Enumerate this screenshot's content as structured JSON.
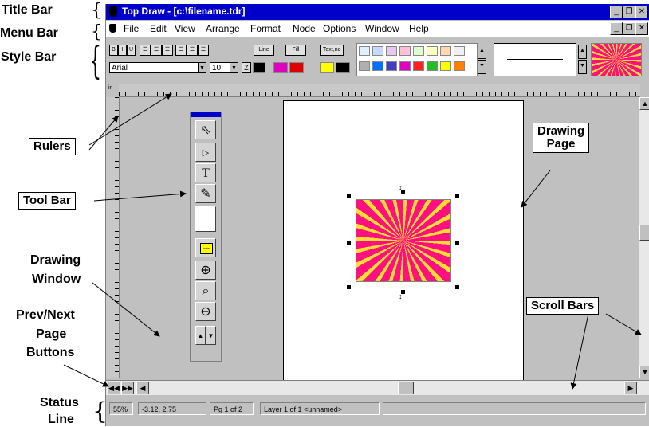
{
  "labels": {
    "title_bar": "Title Bar",
    "menu_bar": "Menu Bar",
    "style_bar": "Style Bar",
    "rulers": "Rulers",
    "tool_bar": "Tool Bar",
    "drawing_window_1": "Drawing",
    "drawing_window_2": "Window",
    "prev_next_1": "Prev/Next",
    "prev_next_2": "Page",
    "prev_next_3": "Buttons",
    "status_line_1": "Status",
    "status_line_2": "Line",
    "drawing_page_1": "Drawing",
    "drawing_page_2": "Page",
    "scroll_bars": "Scroll Bars"
  },
  "window": {
    "title": "Top Draw - [c:\\filename.tdr]"
  },
  "menu": [
    "File",
    "Edit",
    "View",
    "Arrange",
    "Format",
    "Node",
    "Options",
    "Window",
    "Help"
  ],
  "stylebar": {
    "bold": "B",
    "italic": "I",
    "underline": "U",
    "line_btn": "Line",
    "fill_btn": "Fill",
    "text_btn": "Text,nc",
    "font": "Arial",
    "size": "10"
  },
  "toolbox": {
    "text_tool": "T",
    "note_label": "note"
  },
  "status": {
    "zoom": "55%",
    "coords": "-3.12, 2.75",
    "page": "Pg 1 of 2",
    "layer": "Layer 1 of 1 <unnamed>"
  },
  "ruler": {
    "unit": "in"
  },
  "colors": {
    "titlebar": "#0000c8",
    "palette": [
      "#e0f0ff",
      "#c8d8ff",
      "#e8c8f0",
      "#ffc0d8",
      "#e0ffd0",
      "#ffffc0",
      "#ffd8b0",
      "#b0b0b0",
      "#0070ff",
      "#4040c0",
      "#e000c0",
      "#ff2020",
      "#20c020",
      "#ffff00",
      "#ff8000"
    ]
  }
}
